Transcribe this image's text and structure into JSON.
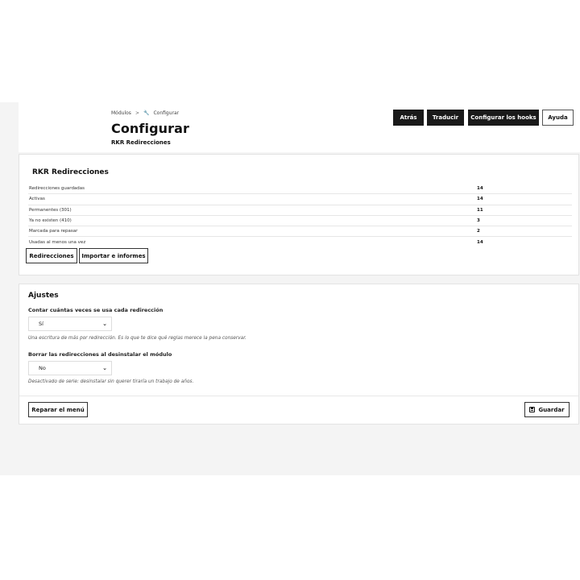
{
  "breadcrumb": {
    "parent": "Módulos",
    "separator": ">",
    "current_icon": "wrench-icon",
    "current": "Configurar"
  },
  "header": {
    "title": "Configurar",
    "subtitle": "RKR Redirecciones"
  },
  "toolbar": {
    "back": "Atrás",
    "translate": "Traducir",
    "hooks": "Configurar los hooks",
    "help": "Ayuda"
  },
  "stats": {
    "heading": "RKR Redirecciones",
    "rows": [
      {
        "label": "Redirecciones guardadas",
        "value": "14"
      },
      {
        "label": "Activas",
        "value": "14"
      },
      {
        "label": "Permanentes (301)",
        "value": "11"
      },
      {
        "label": "Ya no existen (410)",
        "value": "3"
      },
      {
        "label": "Marcada para repasar",
        "value": "2"
      },
      {
        "label": "Usadas al menos una vez",
        "value": "14"
      }
    ],
    "buttons": {
      "redirects": "Redirecciones",
      "import": "Importar e informes"
    }
  },
  "settings": {
    "heading": "Ajustes",
    "field1": {
      "label": "Contar cuántas veces se usa cada redirección",
      "value": "Sí",
      "help": "Una escritura de más por redirección. Es lo que te dice qué reglas merece la pena conservar."
    },
    "field2": {
      "label": "Borrar las redirecciones al desinstalar el módulo",
      "value": "No",
      "help": "Desactivado de serie: desinstalar sin querer tiraría un trabajo de años."
    },
    "repair_label": "Reparar el menú",
    "save_label": "Guardar",
    "save_icon": "floppy-disk-icon"
  }
}
